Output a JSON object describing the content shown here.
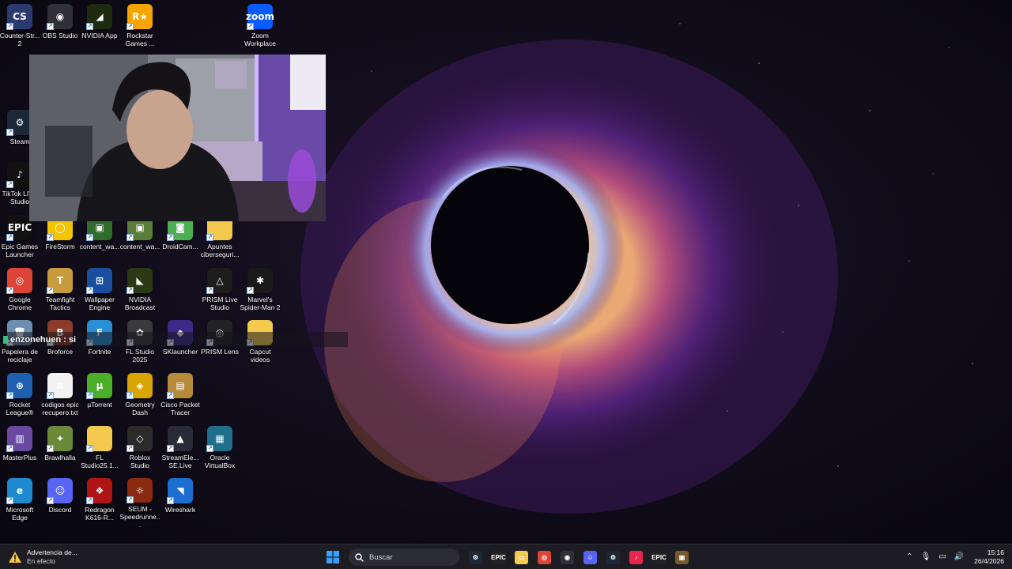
{
  "desktop_icons": [
    {
      "name": "counter-strike-2",
      "label": "Counter-Str... 2",
      "glyph": "CS",
      "bg": "#2a3a6e"
    },
    {
      "name": "obs-studio",
      "label": "OBS Studio",
      "glyph": "◉",
      "bg": "#303038"
    },
    {
      "name": "nvidia-app",
      "label": "NVIDIA App",
      "glyph": "◢",
      "bg": "#1f2b10"
    },
    {
      "name": "rockstar-games",
      "label": "Rockstar Games ...",
      "glyph": "R★",
      "bg": "#f5a400"
    },
    {
      "name": "zoom-workplace",
      "label": "Zoom Workplace",
      "glyph": "zoom",
      "bg": "#0b5cff"
    },
    {
      "name": "steam",
      "label": "Steam",
      "glyph": "⚙",
      "bg": "#1b2838"
    },
    {
      "name": "tiktok-live-studio",
      "label": "TikTok LIVE Studio",
      "glyph": "♪",
      "bg": "#111111"
    },
    {
      "name": "epic-games-launcher",
      "label": "Epic Games Launcher",
      "glyph": "EPIC",
      "bg": "#111111"
    },
    {
      "name": "firestorm",
      "label": "FireStorm",
      "glyph": "◯",
      "bg": "#f2c500"
    },
    {
      "name": "content-warning-1",
      "label": "content_wa...",
      "glyph": "▣",
      "bg": "#2f6b2a"
    },
    {
      "name": "content-warning-2",
      "label": "content_wa...",
      "glyph": "▣",
      "bg": "#5a7d3a"
    },
    {
      "name": "droidcam",
      "label": "DroidCam...",
      "glyph": "◙",
      "bg": "#4caf50"
    },
    {
      "name": "apuntes-ciberseguridad",
      "label": "Apuntes ciberseguri...",
      "glyph": "",
      "bg": "#f3c94e"
    },
    {
      "name": "google-chrome",
      "label": "Google Chrome",
      "glyph": "◎",
      "bg": "#db4437"
    },
    {
      "name": "teamfight-tactics",
      "label": "Teamfight Tactics",
      "glyph": "T",
      "bg": "#c89b3c"
    },
    {
      "name": "wallpaper-engine",
      "label": "Wallpaper Engine",
      "glyph": "⊞",
      "bg": "#1a4fa0"
    },
    {
      "name": "nvidia-broadcast",
      "label": "NVIDIA Broadcast",
      "glyph": "◣",
      "bg": "#2b3a12"
    },
    {
      "name": "prism-live-studio",
      "label": "PRISM Live Studio",
      "glyph": "△",
      "bg": "#1d1d1d"
    },
    {
      "name": "marvels-spider-man-2",
      "label": "Marvel's Spider-Man 2",
      "glyph": "✱",
      "bg": "#1a1a1a"
    },
    {
      "name": "papelera-de-reciclaje",
      "label": "Papelera de reciclaje",
      "glyph": "🗑",
      "bg": "#6c8fb0"
    },
    {
      "name": "broforce",
      "label": "Broforce",
      "glyph": "B",
      "bg": "#8a3b2a"
    },
    {
      "name": "fortnite",
      "label": "Fortnite",
      "glyph": "F",
      "bg": "#2b8fd6"
    },
    {
      "name": "fl-studio-2025",
      "label": "FL Studio 2025",
      "glyph": "✿",
      "bg": "#3a3a3a"
    },
    {
      "name": "sklauncher",
      "label": "SKlauncher",
      "glyph": "◆",
      "bg": "#3b2a8a"
    },
    {
      "name": "prism-lens",
      "label": "PRISM Lens",
      "glyph": "◎",
      "bg": "#222222"
    },
    {
      "name": "capcut-videos",
      "label": "Capcut videos",
      "glyph": "",
      "bg": "#f3c94e"
    },
    {
      "name": "rocket-league",
      "label": "Rocket League®",
      "glyph": "⊕",
      "bg": "#1f5fb0"
    },
    {
      "name": "codigos-epic",
      "label": "codigos epic recupero.txt",
      "glyph": "≡",
      "bg": "#f2f2f2"
    },
    {
      "name": "utorrent",
      "label": "µTorrent",
      "glyph": "µ",
      "bg": "#4caf2a"
    },
    {
      "name": "geometry-dash",
      "label": "Geometry Dash",
      "glyph": "◈",
      "bg": "#d9a500"
    },
    {
      "name": "cisco-packet-tracer",
      "label": "Cisco Packet Tracer",
      "glyph": "▤",
      "bg": "#b78a3a"
    },
    {
      "name": "masterplus",
      "label": "MasterPlus",
      "glyph": "▥",
      "bg": "#6a4aa0"
    },
    {
      "name": "brawlhalla",
      "label": "Brawlhalla",
      "glyph": "✦",
      "bg": "#6a8a3a"
    },
    {
      "name": "fl-studio-folder",
      "label": "FL Studio25.1...",
      "glyph": "",
      "bg": "#f3c94e"
    },
    {
      "name": "roblox-studio",
      "label": "Roblox Studio",
      "glyph": "◇",
      "bg": "#2b2b2b"
    },
    {
      "name": "streamelements-live",
      "label": "StreamEle... SE.Live",
      "glyph": "▲",
      "bg": "#2a2a3a"
    },
    {
      "name": "oracle-virtualbox",
      "label": "Oracle VirtualBox",
      "glyph": "▦",
      "bg": "#1f6f8a"
    },
    {
      "name": "microsoft-edge",
      "label": "Microsoft Edge",
      "glyph": "e",
      "bg": "#1f8ad0"
    },
    {
      "name": "discord",
      "label": "Discord",
      "glyph": "☺",
      "bg": "#5865f2"
    },
    {
      "name": "redragon-k616",
      "label": "Redragon K616-R...",
      "glyph": "❖",
      "bg": "#b01515"
    },
    {
      "name": "seum-speedrunners",
      "label": "SEUM - Speedrunne...",
      "glyph": "☼",
      "bg": "#8a2a10"
    },
    {
      "name": "wireshark",
      "label": "Wireshark",
      "glyph": "◥",
      "bg": "#1c6fd0"
    }
  ],
  "chat_overlay": {
    "text": "enzonehuen : si"
  },
  "taskbar": {
    "alert": {
      "title": "Advertencia de...",
      "subtitle": "En efecto"
    },
    "search_placeholder": "Buscar",
    "pinned": [
      {
        "name": "steam",
        "glyph": "⚙",
        "bg": "#1b2838"
      },
      {
        "name": "epic-games",
        "glyph": "EPIC",
        "bg": "#222222"
      },
      {
        "name": "file-explorer",
        "glyph": "▭",
        "bg": "#f3c94e"
      },
      {
        "name": "chrome",
        "glyph": "◎",
        "bg": "#db4437"
      },
      {
        "name": "obs",
        "glyph": "◉",
        "bg": "#303038"
      },
      {
        "name": "discord",
        "glyph": "☺",
        "bg": "#5865f2"
      },
      {
        "name": "steam-2",
        "glyph": "⚙",
        "bg": "#1b2838"
      },
      {
        "name": "tiktok-live",
        "glyph": "♪",
        "bg": "#e8254d"
      },
      {
        "name": "epic-2",
        "glyph": "EPIC",
        "bg": "#222222"
      },
      {
        "name": "minecraft",
        "glyph": "▣",
        "bg": "#7a5a2a"
      }
    ],
    "time": "15:16",
    "date": "26/4/2026"
  }
}
